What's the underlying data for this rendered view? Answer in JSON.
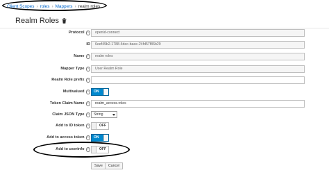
{
  "breadcrumb": {
    "items": [
      "Client Scopes",
      "roles",
      "Mappers"
    ],
    "current": "realm roles",
    "separator": "›"
  },
  "page": {
    "title": "Realm Roles"
  },
  "form": {
    "protocol": {
      "label": "Protocol",
      "value": "openid-connect"
    },
    "id": {
      "label": "ID",
      "value": "6eef49b2-1788-4dec-baee-24fd57f86b29"
    },
    "name": {
      "label": "Name",
      "value": "realm roles"
    },
    "mapper_type": {
      "label": "Mapper Type",
      "value": "User Realm Role"
    },
    "realm_role_prefix": {
      "label": "Realm Role prefix",
      "value": ""
    },
    "multivalued": {
      "label": "Multivalued",
      "state": "ON"
    },
    "token_claim_name": {
      "label": "Token Claim Name",
      "value": "realm_access.roles"
    },
    "claim_json_type": {
      "label": "Claim JSON Type",
      "value": "String"
    },
    "add_to_id_token": {
      "label": "Add to ID token",
      "state": "OFF"
    },
    "add_to_access_token": {
      "label": "Add to access token",
      "state": "ON"
    },
    "add_to_userinfo": {
      "label": "Add to userinfo",
      "state": "OFF"
    }
  },
  "buttons": {
    "save": "Save",
    "cancel": "Cancel"
  },
  "colors": {
    "link": "#0066cc",
    "toggle_on": "#0088ce"
  },
  "icons": {
    "title_action": "trash-icon",
    "help": "help-icon"
  }
}
